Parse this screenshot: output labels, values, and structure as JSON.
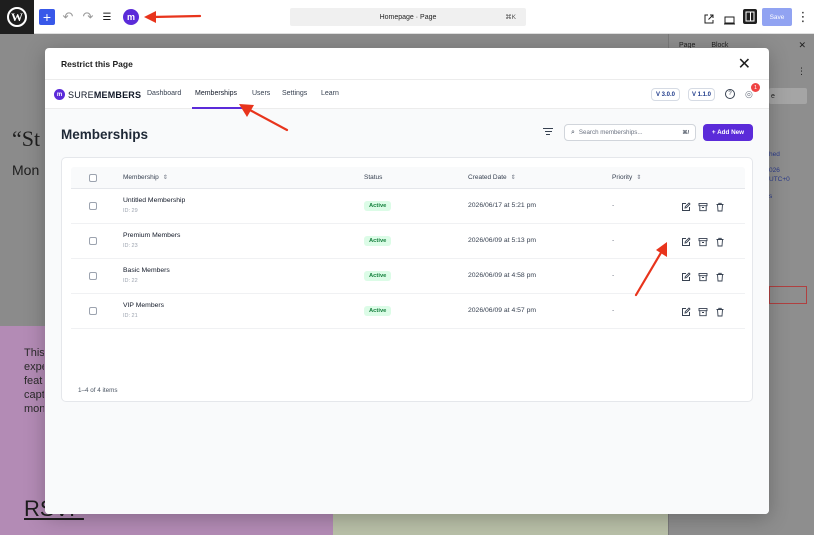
{
  "editor": {
    "doc_title": "Homepage · Page",
    "doc_shortcut": "⌘K",
    "save_label": "Save",
    "add_symbol": "+",
    "undo_symbol": "↶",
    "redo_symbol": "↷",
    "list_symbol": "☰",
    "plugin_letter": "m",
    "wp_letter": "W",
    "more_symbol": "⋮"
  },
  "background": {
    "quote_text": "“St",
    "sub_text": "Mon",
    "para_lines": [
      "This",
      "expe",
      "feat",
      "capt",
      "mon"
    ],
    "rsvp": "RSVP"
  },
  "settings_sidebar": {
    "tab_page": "Page",
    "tab_block": "Block",
    "close": "✕",
    "btn_partial": "e",
    "link_lines": [
      "hed",
      "026",
      "UTC+0",
      "s"
    ]
  },
  "modal": {
    "title": "Restrict this Page",
    "close": "✕"
  },
  "nav": {
    "brand_logo_letter": "m",
    "brand_light": "SURE",
    "brand_bold": "MEMBERS",
    "items": [
      "Dashboard",
      "Memberships",
      "Users",
      "Settings",
      "Learn"
    ],
    "version_1": "V 3.0.0",
    "version_2": "V 1.1.0",
    "help": "?",
    "notification_count": "1",
    "bell": "◎"
  },
  "page": {
    "heading": "Memberships",
    "search_placeholder": "Search memberships...",
    "search_shortcut": "⌘/",
    "search_icon": "⌕",
    "add_new": "+ Add New"
  },
  "table": {
    "headers": {
      "membership": "Membership",
      "status": "Status",
      "created": "Created Date",
      "priority": "Priority",
      "sort_icon": "⇕"
    },
    "rows": [
      {
        "name": "Untitled Membership",
        "id": "ID: 29",
        "status": "Active",
        "date": "2026/06/17 at 5:21 pm",
        "priority": "-"
      },
      {
        "name": "Premium Members",
        "id": "ID: 23",
        "status": "Active",
        "date": "2026/06/09 at 5:13 pm",
        "priority": "-"
      },
      {
        "name": "Basic Members",
        "id": "ID: 22",
        "status": "Active",
        "date": "2026/06/09 at 4:58 pm",
        "priority": "-"
      },
      {
        "name": "VIP Members",
        "id": "ID: 21",
        "status": "Active",
        "date": "2026/06/09 at 4:57 pm",
        "priority": "-"
      }
    ],
    "count": "1–4 of 4 items"
  },
  "colors": {
    "accent": "#5b2bd9",
    "wp_blue": "#3858e9",
    "active_bg": "#dcfce7",
    "active_text": "#15803d",
    "annotation_red": "#e8341c"
  },
  "icons": {
    "row_actions": [
      "edit-icon",
      "archive-icon",
      "trash-icon"
    ],
    "topbar": [
      "view-external-icon",
      "device-preview-icon",
      "settings-panel-icon"
    ]
  }
}
